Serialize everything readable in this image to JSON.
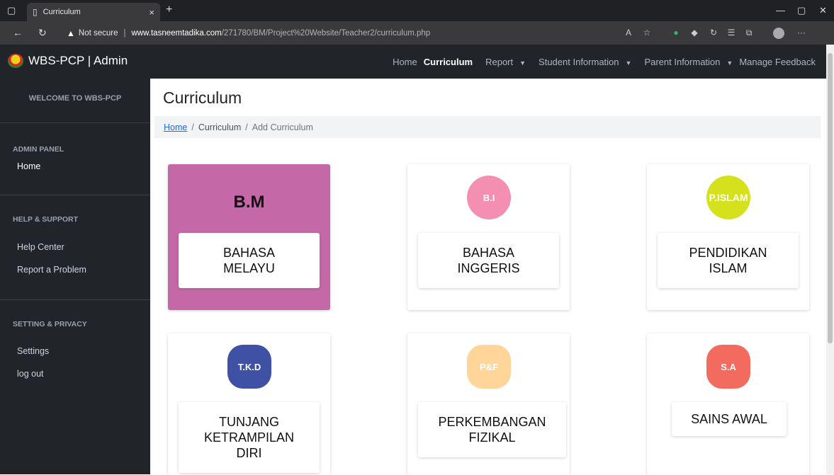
{
  "browser": {
    "tab_title": "Curriculum",
    "tab_close": "×",
    "new_tab": "+",
    "security_label": "Not secure",
    "url_domain": "www.tasneemtadika.com",
    "url_path": "/271780/BM/Project%20Website/Teacher2/curriculum.php"
  },
  "navbar": {
    "brand": "WBS-PCP | Admin",
    "links": [
      {
        "label": "Home"
      },
      {
        "label": "Curriculum"
      },
      {
        "label": "Report"
      },
      {
        "label": "Student Information"
      },
      {
        "label": "Parent Information"
      },
      {
        "label": "Manage Feedback"
      }
    ]
  },
  "sidebar": {
    "welcome": "WELCOME TO WBS-PCP",
    "admin_header": "ADMIN PANEL",
    "home": "Home",
    "help_header": "HELP & SUPPORT",
    "help_center": "Help Center",
    "report_problem": "Report a Problem",
    "settings_header": "SETTING & PRIVACY",
    "settings": "Settings",
    "logout": "log out"
  },
  "main": {
    "title": "Curriculum",
    "breadcrumb": {
      "home": "Home",
      "mid": "Curriculum",
      "current": "Add Curriculum"
    },
    "cards": [
      {
        "badge": "B.M",
        "label_1": "BAHASA",
        "label_2": "MELAYU",
        "label_3": ""
      },
      {
        "badge": "B.I",
        "label_1": "BAHASA",
        "label_2": "INGGERIS",
        "label_3": ""
      },
      {
        "badge": "P.ISLAM",
        "label_1": "PENDIDIKAN",
        "label_2": "ISLAM",
        "label_3": ""
      },
      {
        "badge": "T.K.D",
        "label_1": "TUNJANG",
        "label_2": "KETRAMPILAN",
        "label_3": "DIRI"
      },
      {
        "badge": "P&F",
        "label_1": "PERKEMBANGAN",
        "label_2": "FIZIKAL",
        "label_3": ""
      },
      {
        "badge": "S.A",
        "label_1": "SAINS AWAL",
        "label_2": "",
        "label_3": ""
      }
    ]
  },
  "colors": {
    "highlight_card": "#c568a8",
    "badge_bi": "#f48fb1",
    "badge_pislam": "#d4e11c",
    "badge_tkd": "#3f51a5",
    "badge_pf": "#ffd59a",
    "badge_sa": "#f36b5f"
  }
}
